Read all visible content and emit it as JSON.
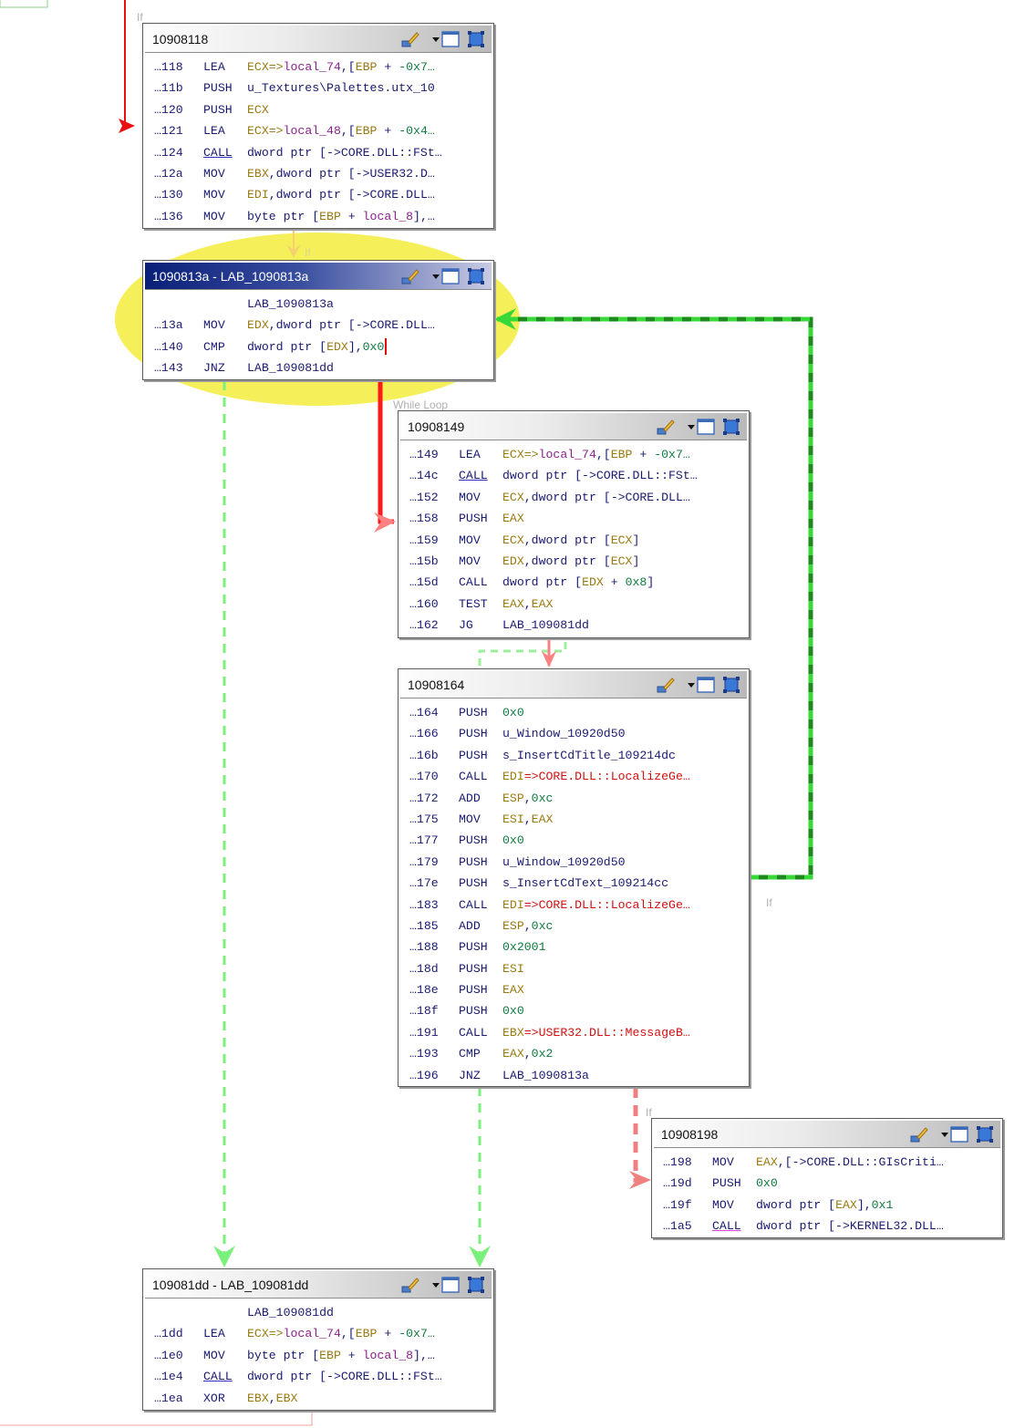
{
  "colors": {
    "fallthrough_edge": "#ff8080",
    "jump_edge": "#80ff80",
    "selected_edge": "#228b22",
    "highlight": "#f5f05a",
    "active_title": "#0a1f78"
  },
  "edge_labels": {
    "top_if": "If",
    "top_if2": "If",
    "while_loop": "While Loop",
    "right_if": "If",
    "bottom_if": "If"
  },
  "toolbar_icons": [
    "brush-icon",
    "chevron-down-icon",
    "window-icon",
    "maximize-icon"
  ],
  "blocks": {
    "b118": {
      "title": "10908118",
      "rows": [
        {
          "addr": "…118",
          "mn": "LEA",
          "ops": [
            {
              "t": "ECX=>",
              "c": "reg"
            },
            {
              "t": "local_74",
              "c": "var"
            },
            {
              "t": ",[",
              "c": "lab"
            },
            {
              "t": "EBP",
              "c": "reg"
            },
            {
              "t": " + ",
              "c": "lab"
            },
            {
              "t": "-0x7…",
              "c": "num"
            }
          ]
        },
        {
          "addr": "…11b",
          "mn": "PUSH",
          "ops": [
            {
              "t": "u_Textures\\Palettes.utx_10",
              "c": "lab"
            }
          ]
        },
        {
          "addr": "…120",
          "mn": "PUSH",
          "ops": [
            {
              "t": "ECX",
              "c": "reg"
            }
          ]
        },
        {
          "addr": "…121",
          "mn": "LEA",
          "ops": [
            {
              "t": "ECX=>",
              "c": "reg"
            },
            {
              "t": "local_48",
              "c": "var"
            },
            {
              "t": ",[",
              "c": "lab"
            },
            {
              "t": "EBP",
              "c": "reg"
            },
            {
              "t": " + ",
              "c": "lab"
            },
            {
              "t": "-0x4…",
              "c": "num"
            }
          ]
        },
        {
          "addr": "…124",
          "mn": "CALL",
          "und": true,
          "ops": [
            {
              "t": "dword ptr [->CORE.DLL::FSt…",
              "c": "lab"
            }
          ]
        },
        {
          "addr": "…12a",
          "mn": "MOV",
          "ops": [
            {
              "t": "EBX",
              "c": "reg"
            },
            {
              "t": ",dword ptr [->USER32.D…",
              "c": "lab"
            }
          ]
        },
        {
          "addr": "…130",
          "mn": "MOV",
          "ops": [
            {
              "t": "EDI",
              "c": "reg"
            },
            {
              "t": ",dword ptr [->CORE.DLL…",
              "c": "lab"
            }
          ]
        },
        {
          "addr": "…136",
          "mn": "MOV",
          "ops": [
            {
              "t": "byte ptr [",
              "c": "lab"
            },
            {
              "t": "EBP",
              "c": "reg"
            },
            {
              "t": " + ",
              "c": "lab"
            },
            {
              "t": "local_8",
              "c": "var"
            },
            {
              "t": "],…",
              "c": "lab"
            }
          ]
        }
      ]
    },
    "b13a": {
      "title": "1090813a - LAB_1090813a",
      "rows": [
        {
          "addr": "",
          "mn": "",
          "ops": [
            {
              "t": "LAB_1090813a",
              "c": "lab"
            }
          ]
        },
        {
          "addr": "…13a",
          "mn": "MOV",
          "ops": [
            {
              "t": "EDX",
              "c": "reg"
            },
            {
              "t": ",dword ptr [->CORE.DLL…",
              "c": "lab"
            }
          ]
        },
        {
          "addr": "…140",
          "mn": "CMP",
          "ops": [
            {
              "t": "dword ptr [",
              "c": "lab"
            },
            {
              "t": "EDX",
              "c": "reg"
            },
            {
              "t": "],",
              "c": "lab"
            },
            {
              "t": "0x0",
              "c": "num"
            }
          ],
          "cursor": true
        },
        {
          "addr": "…143",
          "mn": "JNZ",
          "ops": [
            {
              "t": "LAB_109081dd",
              "c": "lab"
            }
          ]
        }
      ]
    },
    "b149": {
      "title": "10908149",
      "rows": [
        {
          "addr": "…149",
          "mn": "LEA",
          "ops": [
            {
              "t": "ECX=>",
              "c": "reg"
            },
            {
              "t": "local_74",
              "c": "var"
            },
            {
              "t": ",[",
              "c": "lab"
            },
            {
              "t": "EBP",
              "c": "reg"
            },
            {
              "t": " + ",
              "c": "lab"
            },
            {
              "t": "-0x7…",
              "c": "num"
            }
          ]
        },
        {
          "addr": "…14c",
          "mn": "CALL",
          "und": true,
          "ops": [
            {
              "t": "dword ptr [->CORE.DLL::FSt…",
              "c": "lab"
            }
          ]
        },
        {
          "addr": "…152",
          "mn": "MOV",
          "ops": [
            {
              "t": "ECX",
              "c": "reg"
            },
            {
              "t": ",dword ptr [->CORE.DLL…",
              "c": "lab"
            }
          ]
        },
        {
          "addr": "…158",
          "mn": "PUSH",
          "ops": [
            {
              "t": "EAX",
              "c": "reg"
            }
          ]
        },
        {
          "addr": "…159",
          "mn": "MOV",
          "ops": [
            {
              "t": "ECX",
              "c": "reg"
            },
            {
              "t": ",dword ptr [",
              "c": "lab"
            },
            {
              "t": "ECX",
              "c": "reg"
            },
            {
              "t": "]",
              "c": "lab"
            }
          ]
        },
        {
          "addr": "…15b",
          "mn": "MOV",
          "ops": [
            {
              "t": "EDX",
              "c": "reg"
            },
            {
              "t": ",dword ptr [",
              "c": "lab"
            },
            {
              "t": "ECX",
              "c": "reg"
            },
            {
              "t": "]",
              "c": "lab"
            }
          ]
        },
        {
          "addr": "…15d",
          "mn": "CALL",
          "ops": [
            {
              "t": "dword ptr [",
              "c": "lab"
            },
            {
              "t": "EDX",
              "c": "reg"
            },
            {
              "t": " + ",
              "c": "lab"
            },
            {
              "t": "0x8",
              "c": "num"
            },
            {
              "t": "]",
              "c": "lab"
            }
          ]
        },
        {
          "addr": "…160",
          "mn": "TEST",
          "ops": [
            {
              "t": "EAX",
              "c": "reg"
            },
            {
              "t": ",",
              "c": "lab"
            },
            {
              "t": "EAX",
              "c": "reg"
            }
          ]
        },
        {
          "addr": "…162",
          "mn": "JG",
          "ops": [
            {
              "t": "LAB_109081dd",
              "c": "lab"
            }
          ]
        }
      ]
    },
    "b164": {
      "title": "10908164",
      "rows": [
        {
          "addr": "…164",
          "mn": "PUSH",
          "ops": [
            {
              "t": "0x0",
              "c": "num"
            }
          ]
        },
        {
          "addr": "…166",
          "mn": "PUSH",
          "ops": [
            {
              "t": "u_Window_10920d50",
              "c": "lab"
            }
          ]
        },
        {
          "addr": "…16b",
          "mn": "PUSH",
          "ops": [
            {
              "t": "s_InsertCdTitle_109214dc",
              "c": "lab"
            }
          ]
        },
        {
          "addr": "…170",
          "mn": "CALL",
          "ops": [
            {
              "t": "EDI",
              "c": "reg"
            },
            {
              "t": "=>CORE.DLL::LocalizeGe…",
              "c": "err"
            }
          ]
        },
        {
          "addr": "…172",
          "mn": "ADD",
          "ops": [
            {
              "t": "ESP",
              "c": "reg"
            },
            {
              "t": ",",
              "c": "lab"
            },
            {
              "t": "0xc",
              "c": "num"
            }
          ]
        },
        {
          "addr": "…175",
          "mn": "MOV",
          "ops": [
            {
              "t": "ESI",
              "c": "reg"
            },
            {
              "t": ",",
              "c": "lab"
            },
            {
              "t": "EAX",
              "c": "reg"
            }
          ]
        },
        {
          "addr": "…177",
          "mn": "PUSH",
          "ops": [
            {
              "t": "0x0",
              "c": "num"
            }
          ]
        },
        {
          "addr": "…179",
          "mn": "PUSH",
          "ops": [
            {
              "t": "u_Window_10920d50",
              "c": "lab"
            }
          ]
        },
        {
          "addr": "…17e",
          "mn": "PUSH",
          "ops": [
            {
              "t": "s_InsertCdText_109214cc",
              "c": "lab"
            }
          ]
        },
        {
          "addr": "…183",
          "mn": "CALL",
          "ops": [
            {
              "t": "EDI",
              "c": "reg"
            },
            {
              "t": "=>CORE.DLL::LocalizeGe…",
              "c": "err"
            }
          ]
        },
        {
          "addr": "…185",
          "mn": "ADD",
          "ops": [
            {
              "t": "ESP",
              "c": "reg"
            },
            {
              "t": ",",
              "c": "lab"
            },
            {
              "t": "0xc",
              "c": "num"
            }
          ]
        },
        {
          "addr": "…188",
          "mn": "PUSH",
          "ops": [
            {
              "t": "0x2001",
              "c": "num"
            }
          ]
        },
        {
          "addr": "…18d",
          "mn": "PUSH",
          "ops": [
            {
              "t": "ESI",
              "c": "reg"
            }
          ]
        },
        {
          "addr": "…18e",
          "mn": "PUSH",
          "ops": [
            {
              "t": "EAX",
              "c": "reg"
            }
          ]
        },
        {
          "addr": "…18f",
          "mn": "PUSH",
          "ops": [
            {
              "t": "0x0",
              "c": "num"
            }
          ]
        },
        {
          "addr": "…191",
          "mn": "CALL",
          "ops": [
            {
              "t": "EBX",
              "c": "reg"
            },
            {
              "t": "=>USER32.DLL::MessageB…",
              "c": "err"
            }
          ]
        },
        {
          "addr": "…193",
          "mn": "CMP",
          "ops": [
            {
              "t": "EAX",
              "c": "reg"
            },
            {
              "t": ",",
              "c": "lab"
            },
            {
              "t": "0x2",
              "c": "num"
            }
          ]
        },
        {
          "addr": "…196",
          "mn": "JNZ",
          "ops": [
            {
              "t": "LAB_1090813a",
              "c": "lab"
            }
          ]
        }
      ]
    },
    "b198": {
      "title": "10908198",
      "rows": [
        {
          "addr": "…198",
          "mn": "MOV",
          "ops": [
            {
              "t": "EAX",
              "c": "reg"
            },
            {
              "t": ",[->CORE.DLL::GIsCriti…",
              "c": "lab"
            }
          ]
        },
        {
          "addr": "…19d",
          "mn": "PUSH",
          "ops": [
            {
              "t": "0x0",
              "c": "num"
            }
          ]
        },
        {
          "addr": "…19f",
          "mn": "MOV",
          "ops": [
            {
              "t": "dword ptr [",
              "c": "lab"
            },
            {
              "t": "EAX",
              "c": "reg"
            },
            {
              "t": "],",
              "c": "lab"
            },
            {
              "t": "0x1",
              "c": "num"
            }
          ]
        },
        {
          "addr": "…1a5",
          "mn": "CALL",
          "und2": true,
          "ops": [
            {
              "t": "dword ptr [->KERNEL32.DLL…",
              "c": "lab"
            }
          ]
        }
      ]
    },
    "b1dd": {
      "title": "109081dd - LAB_109081dd",
      "rows": [
        {
          "addr": "",
          "mn": "",
          "ops": [
            {
              "t": "LAB_109081dd",
              "c": "lab"
            }
          ]
        },
        {
          "addr": "…1dd",
          "mn": "LEA",
          "ops": [
            {
              "t": "ECX=>",
              "c": "reg"
            },
            {
              "t": "local_74",
              "c": "var"
            },
            {
              "t": ",[",
              "c": "lab"
            },
            {
              "t": "EBP",
              "c": "reg"
            },
            {
              "t": " + ",
              "c": "lab"
            },
            {
              "t": "-0x7…",
              "c": "num"
            }
          ]
        },
        {
          "addr": "…1e0",
          "mn": "MOV",
          "ops": [
            {
              "t": "byte ptr [",
              "c": "lab"
            },
            {
              "t": "EBP",
              "c": "reg"
            },
            {
              "t": " + ",
              "c": "lab"
            },
            {
              "t": "local_8",
              "c": "var"
            },
            {
              "t": "],…",
              "c": "lab"
            }
          ]
        },
        {
          "addr": "…1e4",
          "mn": "CALL",
          "und": true,
          "ops": [
            {
              "t": "dword ptr [->CORE.DLL::FSt…",
              "c": "lab"
            }
          ]
        },
        {
          "addr": "…1ea",
          "mn": "XOR",
          "ops": [
            {
              "t": "EBX",
              "c": "reg"
            },
            {
              "t": ",",
              "c": "lab"
            },
            {
              "t": "EBX",
              "c": "reg"
            }
          ]
        }
      ]
    }
  }
}
